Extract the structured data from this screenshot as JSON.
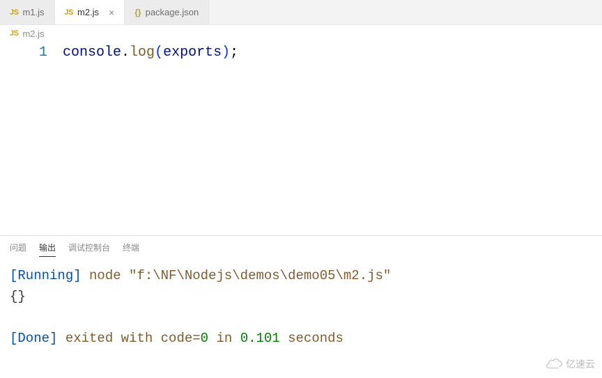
{
  "tabs": [
    {
      "icon": "JS",
      "label": "m1.js",
      "active": false,
      "close": ""
    },
    {
      "icon": "JS",
      "label": "m2.js",
      "active": true,
      "close": "×"
    },
    {
      "icon": "{}",
      "label": "package.json",
      "active": false,
      "close": ""
    }
  ],
  "breadcrumb": {
    "icon": "JS",
    "file": "m2.js"
  },
  "editor": {
    "line_number": "1",
    "code": {
      "console": "console",
      "dot": ".",
      "log": "log",
      "lpar": "(",
      "exports": "exports",
      "rpar": ")",
      "semi": ";"
    }
  },
  "panel": {
    "tabs": {
      "problems": "问题",
      "output": "输出",
      "debug": "调试控制台",
      "terminal": "终端"
    },
    "out": {
      "running_tag": "[Running]",
      "cmd": "node",
      "path": "\"f:\\NF\\Nodejs\\demos\\demo05\\m2.js\"",
      "result": "{}",
      "done_tag": "[Done]",
      "exited": "exited with",
      "code_label": "code=",
      "code_val": "0",
      "in": "in",
      "time_val": "0.101",
      "seconds": "seconds"
    }
  },
  "watermark": "亿速云"
}
